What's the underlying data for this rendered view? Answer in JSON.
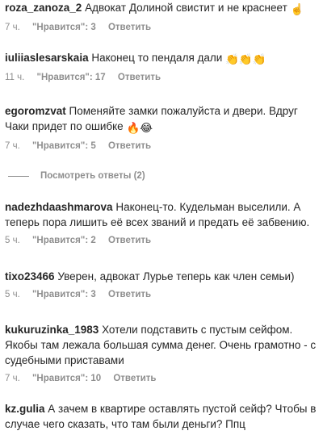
{
  "comments": [
    {
      "user": "roza_zanoza_2",
      "text": "Адвокат Долиной свистит и не краснеет",
      "emoji": "☝️",
      "time": "7 ч.",
      "likes": "\"Нравится\": 3",
      "reply": "Ответить"
    },
    {
      "user": "iuliiaslesarskaia",
      "text": "Наконец то пендаля дали",
      "emoji": "👏👏👏",
      "time": "11 ч.",
      "likes": "\"Нравится\": 17",
      "reply": "Ответить"
    },
    {
      "user": "egoromzvat",
      "text": "Поменяйте замки пожалуйста и двери. Вдруг Чаки придет по ошибке",
      "emoji": "🔥😂",
      "time": "7 ч.",
      "likes": "\"Нравится\": 5",
      "reply": "Ответить"
    },
    {
      "user": "nadezhdaashmarova",
      "text": "Наконец-то. Кудельман выселили. А теперь пора лишить её всех званий и предать её забвению.",
      "emoji": "",
      "time": "5 ч.",
      "likes": "\"Нравится\": 2",
      "reply": "Ответить"
    },
    {
      "user": "tixo23466",
      "text": "Уверен, адвокат Лурье теперь как член семьи)",
      "emoji": "",
      "time": "5 ч.",
      "likes": "\"Нравится\": 3",
      "reply": "Ответить"
    },
    {
      "user": "kukuruzinka_1983",
      "text": "Хотели подставить с пустым сейфом. Якобы там лежала большая сумма денег. Очень грамотно - с судебными приставами",
      "emoji": "",
      "time": "7 ч.",
      "likes": "\"Нравится\": 10",
      "reply": "Ответить"
    },
    {
      "user": "kz.gulia",
      "text": "А зачем в квартире оставлять пустой сейф? Чтобы в случае чего сказать, что там были деньги? Ппц",
      "emoji": "",
      "time": "",
      "likes": "",
      "reply": ""
    }
  ],
  "view_replies": "Посмотреть ответы (2)"
}
